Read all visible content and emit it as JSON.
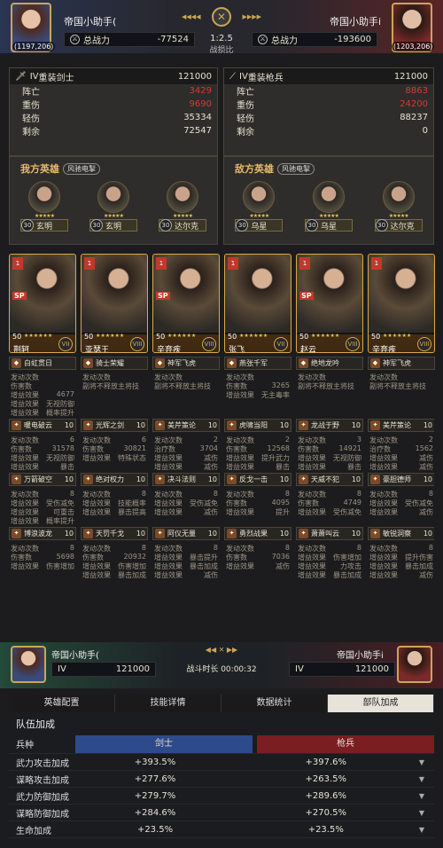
{
  "top": {
    "left": {
      "name": "帝国小助手(",
      "coord": "(1197,206)",
      "power_label": "总战力",
      "power": "-77524"
    },
    "right": {
      "name": "帝国小助手i",
      "coord": "(1203,206)",
      "power_label": "总战力",
      "power": "-193600"
    },
    "ratio": "1:2.5",
    "ratio_label": "战损比"
  },
  "left_troop": {
    "rank": "IV",
    "type": "重装剑士",
    "count": "121000",
    "rows": [
      {
        "label": "阵亡",
        "value": "3429",
        "red": true
      },
      {
        "label": "重伤",
        "value": "9690",
        "red": true
      },
      {
        "label": "轻伤",
        "value": "35334",
        "red": false
      },
      {
        "label": "剩余",
        "value": "72547",
        "red": false
      }
    ]
  },
  "right_troop": {
    "rank": "IV",
    "type": "重装枪兵",
    "count": "121000",
    "rows": [
      {
        "label": "阵亡",
        "value": "8863",
        "red": true
      },
      {
        "label": "重伤",
        "value": "24200",
        "red": true
      },
      {
        "label": "轻伤",
        "value": "88237",
        "red": false
      },
      {
        "label": "剩余",
        "value": "0",
        "red": false
      }
    ]
  },
  "left_heroes": {
    "title": "我方英雄",
    "tag": "风驰电掣",
    "list": [
      {
        "lv": "30",
        "name": "玄明"
      },
      {
        "lv": "30",
        "name": "玄明"
      },
      {
        "lv": "30",
        "name": "达尔克"
      }
    ]
  },
  "right_heroes": {
    "title": "敌方英雄",
    "tag": "风驰电掣",
    "list": [
      {
        "lv": "30",
        "name": "乌星"
      },
      {
        "lv": "30",
        "name": "乌星"
      },
      {
        "lv": "30",
        "name": "达尔克"
      }
    ]
  },
  "cards": [
    {
      "badge": "1",
      "lv": "50",
      "name": "荆轲",
      "rank": "VII",
      "sp": "SP",
      "title": "白虹贯日"
    },
    {
      "badge": "1",
      "lv": "50",
      "name": "亚瑟王",
      "rank": "VIII",
      "sp": "",
      "title": "骑士荣耀"
    },
    {
      "badge": "1",
      "lv": "50",
      "name": "辛弃疾",
      "rank": "VIII",
      "sp": "SP",
      "title": "神军飞虎"
    },
    {
      "badge": "1",
      "lv": "50",
      "name": "张飞",
      "rank": "VII",
      "sp": "",
      "title": "燕张千军"
    },
    {
      "badge": "1",
      "lv": "50",
      "name": "赵云",
      "rank": "VIII",
      "sp": "SP",
      "title": "绝地龙吟"
    },
    {
      "badge": "1",
      "lv": "50",
      "name": "辛弃疾",
      "rank": "VIII",
      "sp": "",
      "title": "神军飞虎"
    }
  ],
  "skills": [
    [
      {
        "lines": [
          [
            "发动次数",
            ""
          ],
          [
            "伤害数",
            ""
          ],
          [
            "增益效果",
            "4677"
          ],
          [
            "增益效果",
            "无视防御"
          ],
          [
            "增益效果",
            "概率提升"
          ]
        ],
        "head": {
          "name": "暖电破云",
          "num": "10"
        }
      },
      {
        "lines": [
          [
            "发动次数",
            ""
          ],
          [
            "副将不释放主将技",
            ""
          ],
          [
            "",
            ""
          ]
        ],
        "head": {
          "name": "光辉之剑",
          "num": "10"
        }
      },
      {
        "lines": [
          [
            "发动次数",
            ""
          ],
          [
            "副将不释放主将技",
            ""
          ],
          [
            "",
            ""
          ]
        ],
        "head": {
          "name": "美芹策论",
          "num": "10"
        }
      },
      {
        "lines": [
          [
            "发动次数",
            ""
          ],
          [
            "伤害数",
            "3265"
          ],
          [
            "增益效果",
            "无主毒率"
          ]
        ],
        "head": {
          "name": "虎啸当阳",
          "num": "10"
        }
      },
      {
        "lines": [
          [
            "发动次数",
            ""
          ],
          [
            "副将不释放主将技",
            ""
          ],
          [
            "",
            ""
          ]
        ],
        "head": {
          "name": "龙战于野",
          "num": "10"
        }
      },
      {
        "lines": [
          [
            "发动次数",
            ""
          ],
          [
            "副将不释放主将技",
            ""
          ],
          [
            "",
            ""
          ]
        ],
        "head": {
          "name": "美芹策论",
          "num": "10"
        }
      }
    ],
    [
      {
        "lines": [
          [
            "发动次数",
            "6"
          ],
          [
            "伤害数",
            "31578"
          ],
          [
            "增益效果",
            "无视防御"
          ],
          [
            "增益效果",
            "暴击"
          ]
        ],
        "head": {
          "name": "万箭破空",
          "num": "10"
        }
      },
      {
        "lines": [
          [
            "发动次数",
            "6"
          ],
          [
            "伤害数",
            "30821"
          ],
          [
            "增益效果",
            "特殊状态"
          ],
          [
            "",
            ""
          ]
        ],
        "head": {
          "name": "绝对权力",
          "num": "10"
        }
      },
      {
        "lines": [
          [
            "发动次数",
            "2"
          ],
          [
            "治疗数",
            "3704"
          ],
          [
            "增益效果",
            "减伤"
          ],
          [
            "增益效果",
            "减伤"
          ]
        ],
        "head": {
          "name": "决斗法则",
          "num": "10"
        }
      },
      {
        "lines": [
          [
            "发动次数",
            "2"
          ],
          [
            "伤害数",
            "12568"
          ],
          [
            "增益效果",
            "提升武力"
          ],
          [
            "增益效果",
            "暴击"
          ]
        ],
        "head": {
          "name": "反戈一击",
          "num": "10"
        }
      },
      {
        "lines": [
          [
            "发动次数",
            "3"
          ],
          [
            "伤害数",
            "14921"
          ],
          [
            "增益效果",
            "无视防御"
          ],
          [
            "增益效果",
            "暴击"
          ]
        ],
        "head": {
          "name": "天威不犯",
          "num": "10"
        }
      },
      {
        "lines": [
          [
            "发动次数",
            "2"
          ],
          [
            "治疗数",
            "1562"
          ],
          [
            "增益效果",
            "减伤"
          ],
          [
            "增益效果",
            "减伤"
          ]
        ],
        "head": {
          "name": "豪胆德师",
          "num": "10"
        }
      }
    ],
    [
      {
        "lines": [
          [
            "发动次数",
            "8"
          ],
          [
            "增益效果",
            "受伤减免"
          ],
          [
            "增益效果",
            "可重击"
          ],
          [
            "增益效果",
            "概率提升"
          ]
        ],
        "head": {
          "name": "博浪波龙",
          "num": "10"
        }
      },
      {
        "lines": [
          [
            "发动次数",
            "8"
          ],
          [
            "增益效果",
            "技能概率"
          ],
          [
            "增益效果",
            "暴击提高"
          ],
          [
            "",
            ""
          ]
        ],
        "head": {
          "name": "天罚千戈",
          "num": "10"
        }
      },
      {
        "lines": [
          [
            "发动次数",
            "8"
          ],
          [
            "增益效果",
            "受伤减免"
          ],
          [
            "增益效果",
            "减伤"
          ],
          [
            "",
            ""
          ]
        ],
        "head": {
          "name": "阿仪无量",
          "num": "10"
        }
      },
      {
        "lines": [
          [
            "发动次数",
            "8"
          ],
          [
            "伤害数",
            "4095"
          ],
          [
            "增益效果",
            "提升"
          ],
          [
            "",
            ""
          ]
        ],
        "head": {
          "name": "勇烈战果",
          "num": "10"
        }
      },
      {
        "lines": [
          [
            "发动次数",
            "8"
          ],
          [
            "伤害数",
            "4749"
          ],
          [
            "增益效果",
            "受伤减免"
          ],
          [
            "",
            ""
          ]
        ],
        "head": {
          "name": "萧萧叫云",
          "num": "10"
        }
      },
      {
        "lines": [
          [
            "发动次数",
            "8"
          ],
          [
            "增益效果",
            "受伤减免"
          ],
          [
            "增益效果",
            "减伤"
          ],
          [
            "",
            ""
          ]
        ],
        "head": {
          "name": "敏锐洞察",
          "num": "10"
        }
      }
    ],
    [
      {
        "lines": [
          [
            "发动次数",
            "8"
          ],
          [
            "伤害数",
            "5698"
          ],
          [
            "增益效果",
            "伤害增加"
          ]
        ]
      },
      {
        "lines": [
          [
            "发动次数",
            "8"
          ],
          [
            "伤害数",
            "20932"
          ],
          [
            "增益效果",
            "伤害增加"
          ],
          [
            "增益效果",
            "暴击加成"
          ]
        ]
      },
      {
        "lines": [
          [
            "发动次数",
            "8"
          ],
          [
            "增益效果",
            "暴击提升"
          ],
          [
            "增益效果",
            "暴击加成"
          ],
          [
            "增益效果",
            "减伤"
          ]
        ]
      },
      {
        "lines": [
          [
            "发动次数",
            "8"
          ],
          [
            "伤害数",
            "7036"
          ],
          [
            "增益效果",
            "减伤"
          ]
        ]
      },
      {
        "lines": [
          [
            "发动次数",
            "8"
          ],
          [
            "增益效果",
            "伤害增加"
          ],
          [
            "增益效果",
            "力攻击"
          ],
          [
            "增益效果",
            "暴击加成"
          ]
        ]
      },
      {
        "lines": [
          [
            "发动次数",
            "8"
          ],
          [
            "增益效果",
            "提升伤害"
          ],
          [
            "增益效果",
            "暴击加成"
          ],
          [
            "增益效果",
            "减伤"
          ]
        ]
      }
    ]
  ],
  "lower": {
    "left_name": "帝国小助手(",
    "right_name": "帝国小助手i",
    "left_rank": "IV",
    "left_count": "121000",
    "right_rank": "IV",
    "right_count": "121000",
    "time_label": "战斗时长 00:00:32"
  },
  "tabs": [
    "英雄配置",
    "技能详情",
    "数据统计",
    "部队加成"
  ],
  "bonus": {
    "title": "队伍加成",
    "col_label": "兵种",
    "left_type": "剑士",
    "right_type": "枪兵",
    "rows": [
      {
        "label": "武力攻击加成",
        "left": "+393.5%",
        "right": "+397.6%"
      },
      {
        "label": "谋略攻击加成",
        "left": "+277.6%",
        "right": "+263.5%"
      },
      {
        "label": "武力防御加成",
        "left": "+279.7%",
        "right": "+289.6%"
      },
      {
        "label": "谋略防御加成",
        "left": "+284.6%",
        "right": "+270.5%"
      },
      {
        "label": "生命加成",
        "left": "+23.5%",
        "right": "+23.5%"
      }
    ]
  },
  "colors": {
    "gold": "#e6b86a",
    "red": "#d23b2f",
    "blue": "#2d4a8a",
    "crimson": "#7a1e22"
  }
}
